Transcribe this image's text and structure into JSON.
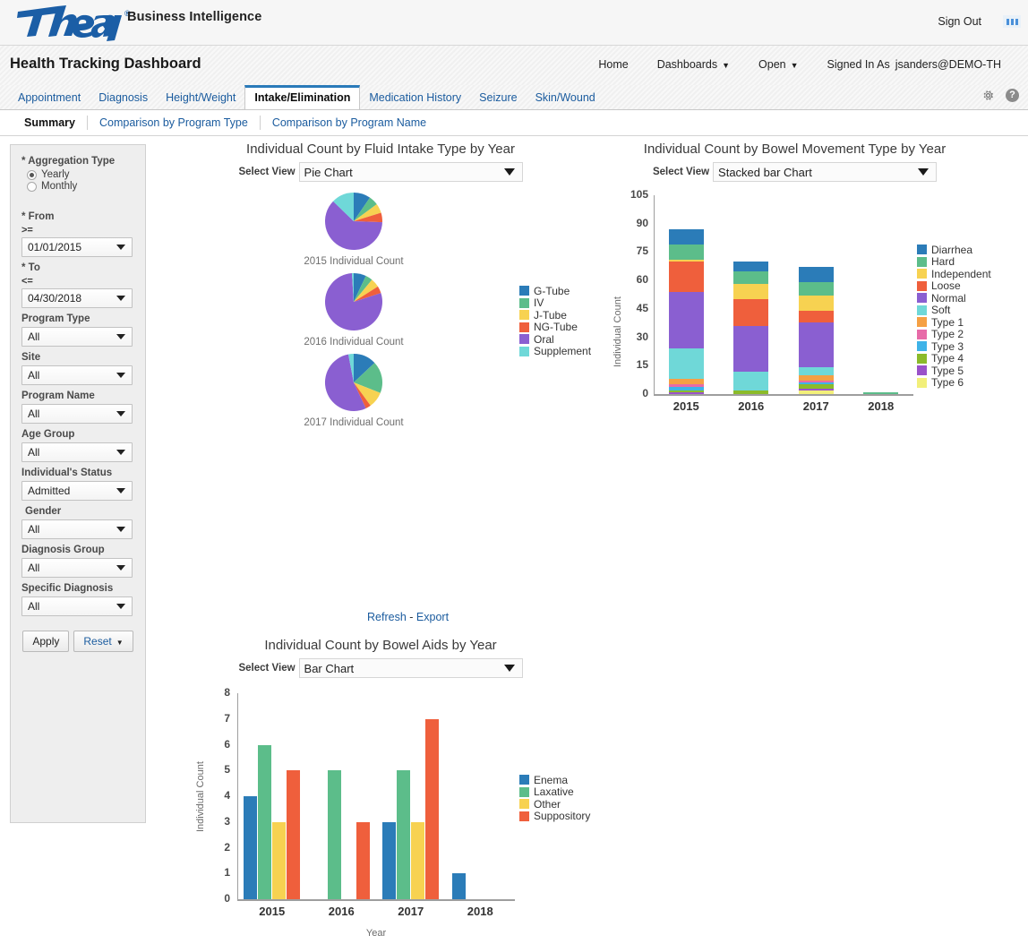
{
  "brand": {
    "logo_text": "Therap",
    "reg": "®",
    "product": "Business Intelligence",
    "sign_out": "Sign Out",
    "grid_icon": "apps-grid-icon"
  },
  "header": {
    "title": "Health Tracking Dashboard",
    "nav": [
      {
        "label": "Home",
        "caret": false
      },
      {
        "label": "Dashboards",
        "caret": true
      },
      {
        "label": "Open",
        "caret": true
      }
    ],
    "signed_in_label": "Signed In As",
    "signed_in_user": "jsanders@DEMO-TH",
    "gear_icon": "gear-icon",
    "help_icon": "help-icon"
  },
  "tabs": [
    {
      "label": "Appointment",
      "active": false
    },
    {
      "label": "Diagnosis",
      "active": false
    },
    {
      "label": "Height/Weight",
      "active": false
    },
    {
      "label": "Intake/Elimination",
      "active": true
    },
    {
      "label": "Medication History",
      "active": false
    },
    {
      "label": "Seizure",
      "active": false
    },
    {
      "label": "Skin/Wound",
      "active": false
    }
  ],
  "subtabs": [
    {
      "label": "Summary",
      "active": true
    },
    {
      "label": "Comparison by Program Type",
      "active": false
    },
    {
      "label": "Comparison by Program Name",
      "active": false
    }
  ],
  "filters": {
    "aggregation_label": "* Aggregation Type",
    "aggregation_options": [
      {
        "label": "Yearly",
        "selected": true
      },
      {
        "label": "Monthly",
        "selected": false
      }
    ],
    "from_label": "* From",
    "from_op": ">=",
    "from_value": "01/01/2015",
    "to_label": "* To",
    "to_op": "<=",
    "to_value": "04/30/2018",
    "fields": [
      {
        "label": "Program Type",
        "value": "All"
      },
      {
        "label": "Site",
        "value": "All"
      },
      {
        "label": "Program Name",
        "value": "All"
      },
      {
        "label": "Age Group",
        "value": "All"
      },
      {
        "label": "Individual's Status",
        "value": "Admitted"
      },
      {
        "label": "Gender",
        "value": "All"
      },
      {
        "label": "Diagnosis Group",
        "value": "All"
      },
      {
        "label": "Specific Diagnosis",
        "value": "All"
      }
    ],
    "apply_label": "Apply",
    "reset_label": "Reset"
  },
  "select_view_label": "Select View",
  "links": {
    "refresh": "Refresh",
    "separator": "-",
    "export": "Export"
  },
  "chart_data": [
    {
      "type": "pie",
      "id": "fluid-intake",
      "title": "Individual Count by Fluid Intake Type by Year",
      "view": "Pie Chart",
      "legend_position": "right",
      "legend": [
        "G-Tube",
        "IV",
        "J-Tube",
        "NG-Tube",
        "Oral",
        "Supplement"
      ],
      "colors": [
        "#2b7cb8",
        "#5cbd8a",
        "#f7d košt"
      ],
      "palette": [
        "#2b7cb8",
        "#5cbd8a",
        "#f7d251",
        "#ef5f3c",
        "#8a5fd1",
        "#6fd8d8"
      ],
      "pies": [
        {
          "caption": "2015 Individual Count",
          "labels": [
            "G-Tube",
            "IV",
            "J-Tube",
            "NG-Tube",
            "Oral",
            "Supplement"
          ],
          "values": [
            9,
            5,
            5,
            5,
            58,
            12
          ]
        },
        {
          "caption": "2016 Individual Count",
          "labels": [
            "G-Tube",
            "IV",
            "J-Tube",
            "NG-Tube",
            "Oral",
            "Supplement"
          ],
          "values": [
            7,
            4,
            5,
            4,
            79,
            1
          ]
        },
        {
          "caption": "2017 Individual Count",
          "labels": [
            "G-Tube",
            "IV",
            "J-Tube",
            "NG-Tube",
            "Oral",
            "Supplement"
          ],
          "values": [
            13,
            18,
            9,
            3,
            54,
            3
          ]
        }
      ]
    },
    {
      "type": "bar",
      "stacked": true,
      "id": "bowel-movement",
      "title": "Individual Count by Bowel Movement Type by Year",
      "view": "Stacked bar Chart",
      "ylabel": "Individual Count",
      "xlabel": "",
      "ylim": [
        0,
        105
      ],
      "yticks": [
        0,
        15,
        30,
        45,
        60,
        75,
        90,
        105
      ],
      "categories": [
        "2015",
        "2016",
        "2017",
        "2018"
      ],
      "legend_position": "right",
      "series": [
        {
          "name": "Diarrhea",
          "color": "#2b7cb8",
          "values": [
            8,
            5,
            8,
            0
          ]
        },
        {
          "name": "Hard",
          "color": "#5cbd8a",
          "values": [
            8,
            7,
            7,
            1
          ]
        },
        {
          "name": "Independent",
          "color": "#f7d251",
          "values": [
            1,
            8,
            8,
            0
          ]
        },
        {
          "name": "Loose",
          "color": "#ef5f3c",
          "values": [
            16,
            14,
            6,
            0
          ]
        },
        {
          "name": "Normal",
          "color": "#8a5fd1",
          "values": [
            30,
            24,
            24,
            0
          ]
        },
        {
          "name": "Soft",
          "color": "#6fd8d8",
          "values": [
            16,
            10,
            4,
            0
          ]
        },
        {
          "name": "Type 1",
          "color": "#f5a044",
          "values": [
            3,
            0,
            3,
            0
          ]
        },
        {
          "name": "Type 2",
          "color": "#e76ba8",
          "values": [
            1,
            0,
            1,
            0
          ]
        },
        {
          "name": "Type 3",
          "color": "#3eb3e8",
          "values": [
            2,
            0,
            1,
            0
          ]
        },
        {
          "name": "Type 4",
          "color": "#8bbb2a",
          "values": [
            1,
            2,
            2,
            0
          ]
        },
        {
          "name": "Type 5",
          "color": "#9a52c9",
          "values": [
            1,
            0,
            1,
            0
          ]
        },
        {
          "name": "Type 6",
          "color": "#f2ef7a",
          "values": [
            0,
            0,
            2,
            0
          ]
        }
      ],
      "totals": [
        87,
        73,
        67,
        1
      ]
    },
    {
      "type": "bar",
      "stacked": false,
      "id": "bowel-aids",
      "title": "Individual Count by Bowel Aids by Year",
      "view": "Bar Chart",
      "ylabel": "Individual Count",
      "xlabel": "Year",
      "ylim": [
        0,
        8
      ],
      "yticks": [
        0,
        1,
        2,
        3,
        4,
        5,
        6,
        7,
        8
      ],
      "categories": [
        "2015",
        "2016",
        "2017",
        "2018"
      ],
      "legend_position": "right",
      "series": [
        {
          "name": "Enema",
          "color": "#2b7cb8",
          "values": [
            4,
            0,
            3,
            1
          ]
        },
        {
          "name": "Laxative",
          "color": "#5cbd8a",
          "values": [
            6,
            5,
            5,
            0
          ]
        },
        {
          "name": "Other",
          "color": "#f7d251",
          "values": [
            3,
            0,
            3,
            0
          ]
        },
        {
          "name": "Suppository",
          "color": "#ef5f3c",
          "values": [
            5,
            3,
            7,
            0
          ]
        }
      ]
    }
  ]
}
